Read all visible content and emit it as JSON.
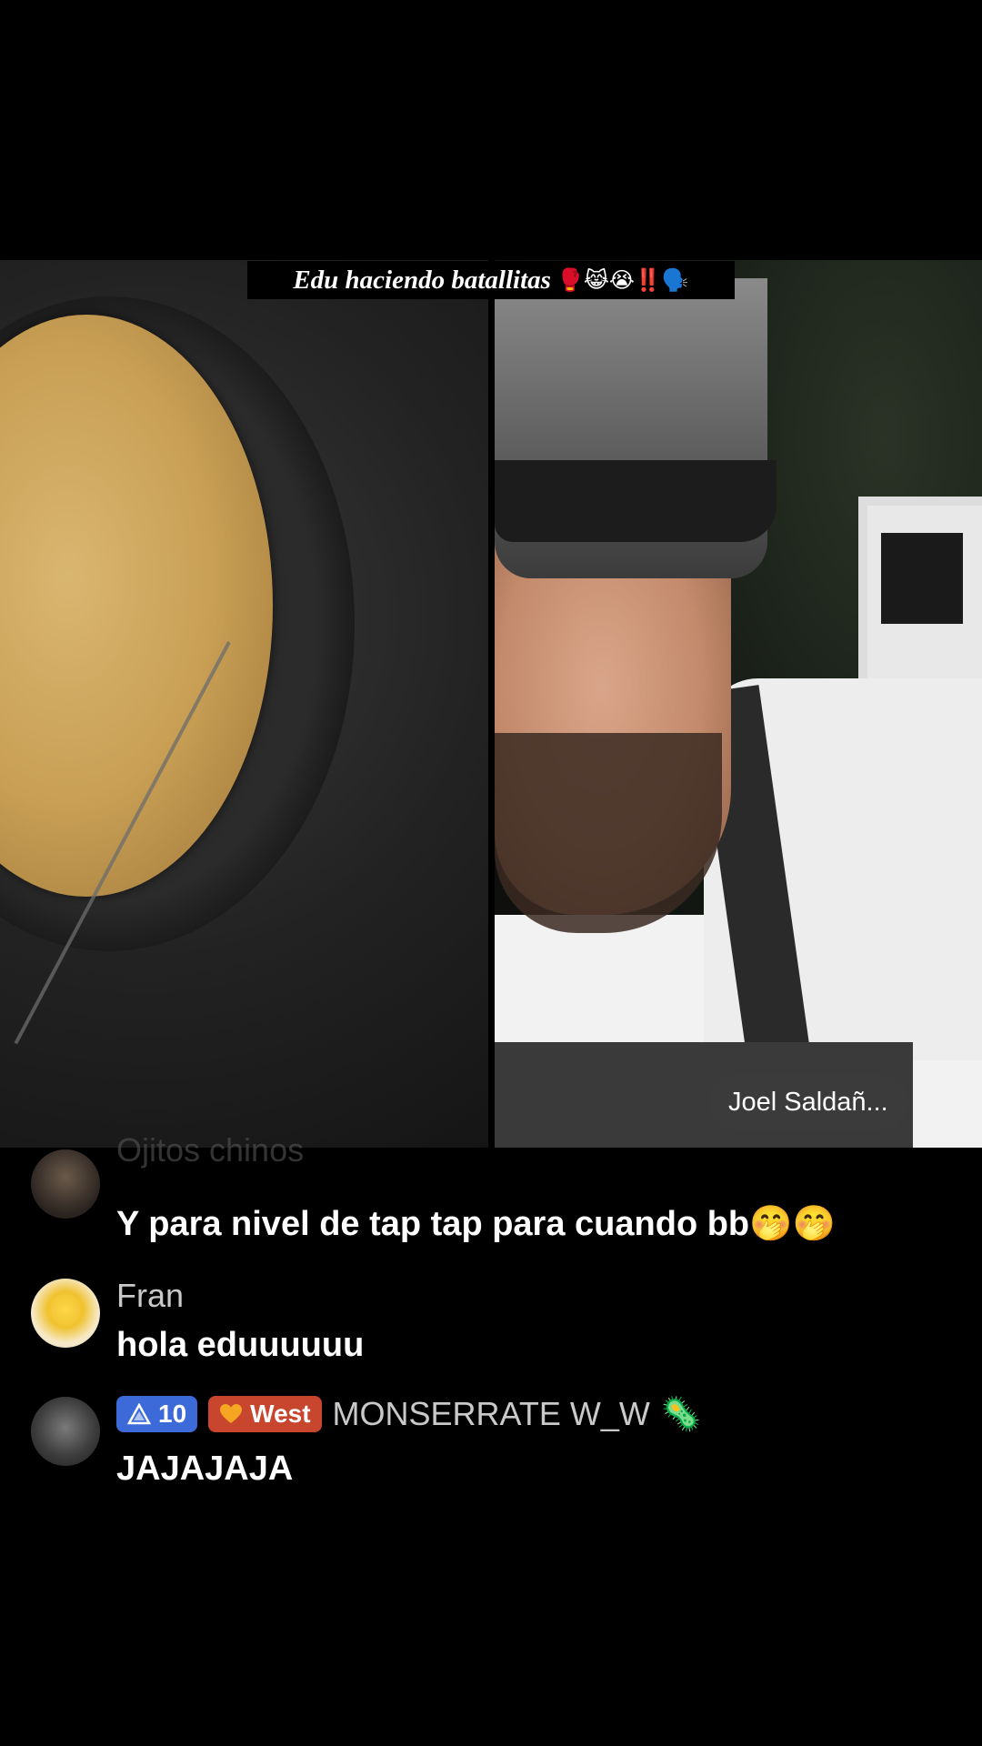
{
  "video": {
    "title": "Edu haciendo batallitas",
    "title_emojis": "🥊😹😭‼️🗣️",
    "right_host_name": "Joel Saldañ..."
  },
  "chat": [
    {
      "username": "Ojitos chinos",
      "text": "Y para nivel de tap tap para cuando bb🤭🤭"
    },
    {
      "username": "Fran",
      "text": "hola eduuuuuu"
    },
    {
      "badges": [
        {
          "icon": "diamond-level-icon",
          "label": "10"
        },
        {
          "icon": "heart-team-icon",
          "label": "West"
        }
      ],
      "username": "MONSERRATE W_W",
      "username_emoji": "🦠",
      "text": "JAJAJAJA"
    }
  ],
  "colors": {
    "background": "#000000",
    "level_badge": "#3c6ad8",
    "team_badge": "#c8462e"
  }
}
